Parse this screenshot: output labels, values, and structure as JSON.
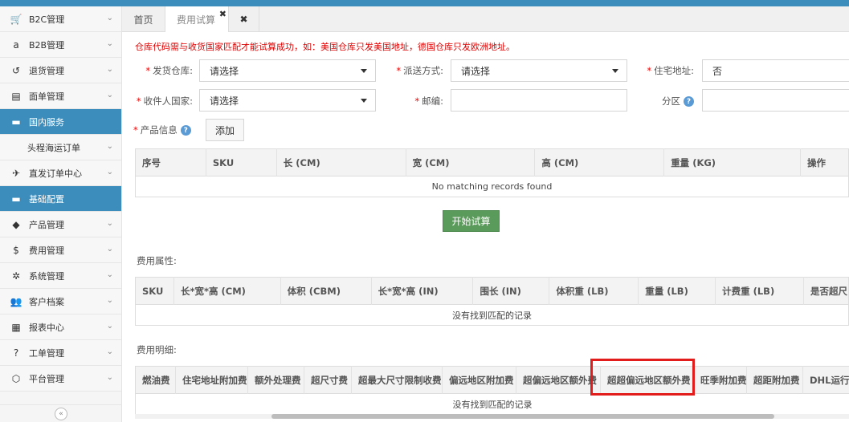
{
  "sidebar": {
    "items": [
      {
        "label": "B2C管理",
        "icon": "cart-icon",
        "glyph": "🛒",
        "active": false
      },
      {
        "label": "B2B管理",
        "icon": "amazon-icon",
        "glyph": "a",
        "active": false
      },
      {
        "label": "退货管理",
        "icon": "return-icon",
        "glyph": "↺",
        "active": false
      },
      {
        "label": "面单管理",
        "icon": "document-icon",
        "glyph": "▤",
        "active": false
      },
      {
        "label": "国内服务",
        "icon": "folder-icon",
        "glyph": "▬",
        "active": true
      },
      {
        "label": "头程海运订单",
        "icon": "",
        "glyph": "",
        "active": false,
        "sub": true
      },
      {
        "label": "直发订单中心",
        "icon": "plane-icon",
        "glyph": "✈",
        "active": false
      },
      {
        "label": "基础配置",
        "icon": "folder-icon",
        "glyph": "▬",
        "active": true
      },
      {
        "label": "产品管理",
        "icon": "tag-icon",
        "glyph": "◆",
        "active": false
      },
      {
        "label": "费用管理",
        "icon": "dollar-icon",
        "glyph": "$",
        "active": false
      },
      {
        "label": "系统管理",
        "icon": "gear-icon",
        "glyph": "✲",
        "active": false
      },
      {
        "label": "客户档案",
        "icon": "users-icon",
        "glyph": "👥",
        "active": false
      },
      {
        "label": "报表中心",
        "icon": "table-icon",
        "glyph": "▦",
        "active": false
      },
      {
        "label": "工单管理",
        "icon": "question-icon",
        "glyph": "?",
        "active": false
      },
      {
        "label": "平台管理",
        "icon": "cube-icon",
        "glyph": "⬡",
        "active": false
      }
    ],
    "collapse_glyph": "«"
  },
  "tabs": [
    {
      "label": "首页",
      "active": false
    },
    {
      "label": "费用试算",
      "active": true,
      "close": "✖"
    }
  ],
  "tab_close_all": "✖",
  "notice": "仓库代码需与收货国家匹配才能试算成功，如：美国仓库只发美国地址，德国仓库只发欧洲地址。",
  "form": {
    "warehouse_label": "发货仓库:",
    "warehouse_value": "请选择",
    "delivery_label": "派送方式:",
    "delivery_value": "请选择",
    "residential_label": "住宅地址:",
    "residential_value": "否",
    "country_label": "收件人国家:",
    "country_value": "请选择",
    "zip_label": "邮编:",
    "zip_value": "",
    "zone_label": "分区",
    "zone_value": "",
    "product_label": "产品信息",
    "add_label": "添加",
    "required_mark": "*",
    "help_glyph": "?"
  },
  "product_table": {
    "headers": [
      "序号",
      "SKU",
      "长 (CM)",
      "宽 (CM)",
      "高 (CM)",
      "重量 (KG)",
      "操作"
    ],
    "empty": "No matching records found"
  },
  "start_button": "开始试算",
  "attr_section": {
    "label": "费用属性:",
    "headers": [
      "SKU",
      "长*宽*高 (CM)",
      "体积 (CBM)",
      "长*宽*高 (IN)",
      "围长 (IN)",
      "体积重 (LB)",
      "重量 (LB)",
      "计费重 (LB)",
      "是否超尺"
    ],
    "empty": "没有找到匹配的记录"
  },
  "detail_section": {
    "label": "费用明细:",
    "headers": [
      "燃油费",
      "住宅地址附加费",
      "额外处理费",
      "超尺寸费",
      "超最大尺寸限制收费",
      "偏远地区附加费",
      "超偏远地区额外费",
      "超超偏远地区额外费",
      "旺季附加费",
      "超距附加费",
      "DHL运行"
    ],
    "empty": "没有找到匹配的记录"
  },
  "colors": {
    "accent": "#3c8dbc",
    "required": "#e00000",
    "start_button": "#5a9a5a",
    "highlight": "#e21b1b"
  }
}
